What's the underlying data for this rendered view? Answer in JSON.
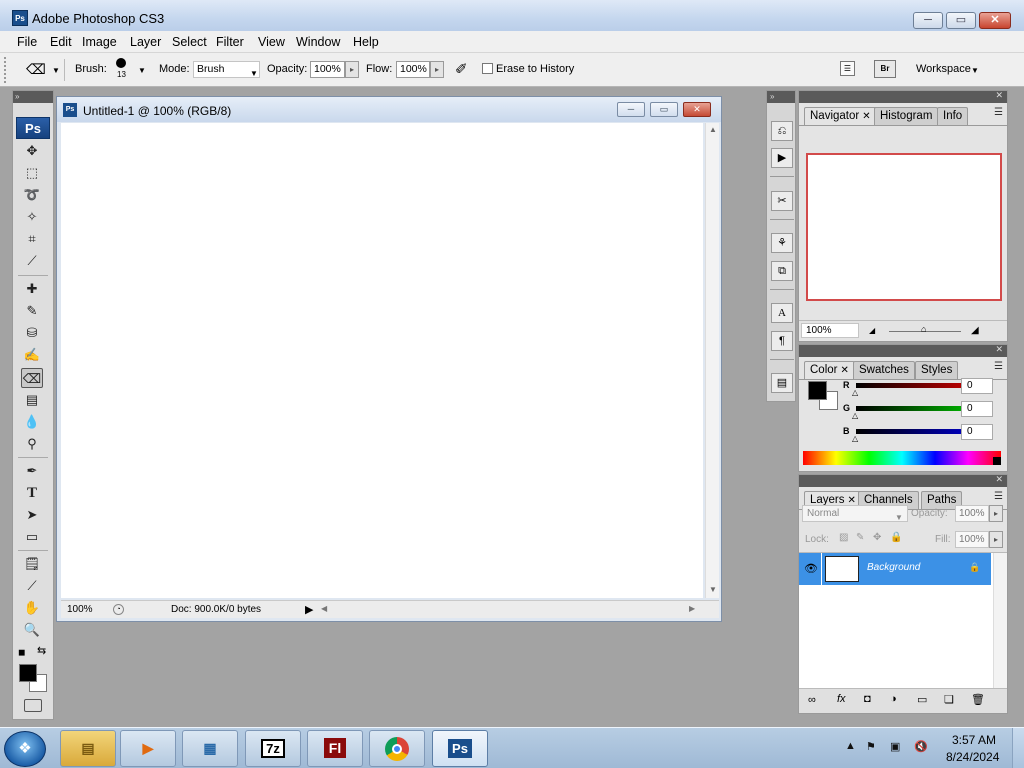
{
  "window": {
    "title": "Adobe Photoshop CS3",
    "min": "─",
    "max": "▭",
    "close": "✕"
  },
  "menu": [
    "File",
    "Edit",
    "Image",
    "Layer",
    "Select",
    "Filter",
    "View",
    "Window",
    "Help"
  ],
  "options": {
    "brush_label": "Brush:",
    "brush_size": "13",
    "mode_label": "Mode:",
    "mode_value": "Brush",
    "opacity_label": "Opacity:",
    "opacity_value": "100%",
    "flow_label": "Flow:",
    "flow_value": "100%",
    "erase_to_history": "Erase to History",
    "workspace": "Workspace"
  },
  "toolbox": {
    "logo": "Ps",
    "collapse": "»"
  },
  "document": {
    "title": "Untitled-1 @ 100% (RGB/8)",
    "zoom": "100%",
    "doc_info": "Doc: 900.0K/0 bytes"
  },
  "navigator": {
    "tabs": [
      "Navigator",
      "Histogram",
      "Info"
    ],
    "zoom": "100%"
  },
  "color": {
    "tabs": [
      "Color",
      "Swatches",
      "Styles"
    ],
    "channels": [
      {
        "label": "R",
        "value": "0",
        "color": "#cc0000"
      },
      {
        "label": "G",
        "value": "0",
        "color": "#00a000"
      },
      {
        "label": "B",
        "value": "0",
        "color": "#0000cc"
      }
    ]
  },
  "layers": {
    "tabs": [
      "Layers",
      "Channels",
      "Paths"
    ],
    "blend_mode": "Normal",
    "opacity_label": "Opacity:",
    "opacity_value": "100%",
    "lock_label": "Lock:",
    "fill_label": "Fill:",
    "fill_value": "100%",
    "layer_name": "Background"
  },
  "taskbar": {
    "time": "3:57 AM",
    "date": "8/24/2024",
    "apps": [
      "explorer",
      "media-player",
      "control-panel",
      "7z",
      "Fl",
      "chrome",
      "Ps"
    ],
    "seven_zip": "7z",
    "flash": "Fl",
    "photoshop": "Ps"
  },
  "colors": {
    "accent": "#3c91e6",
    "navigator_frame": "#d24a4a"
  }
}
